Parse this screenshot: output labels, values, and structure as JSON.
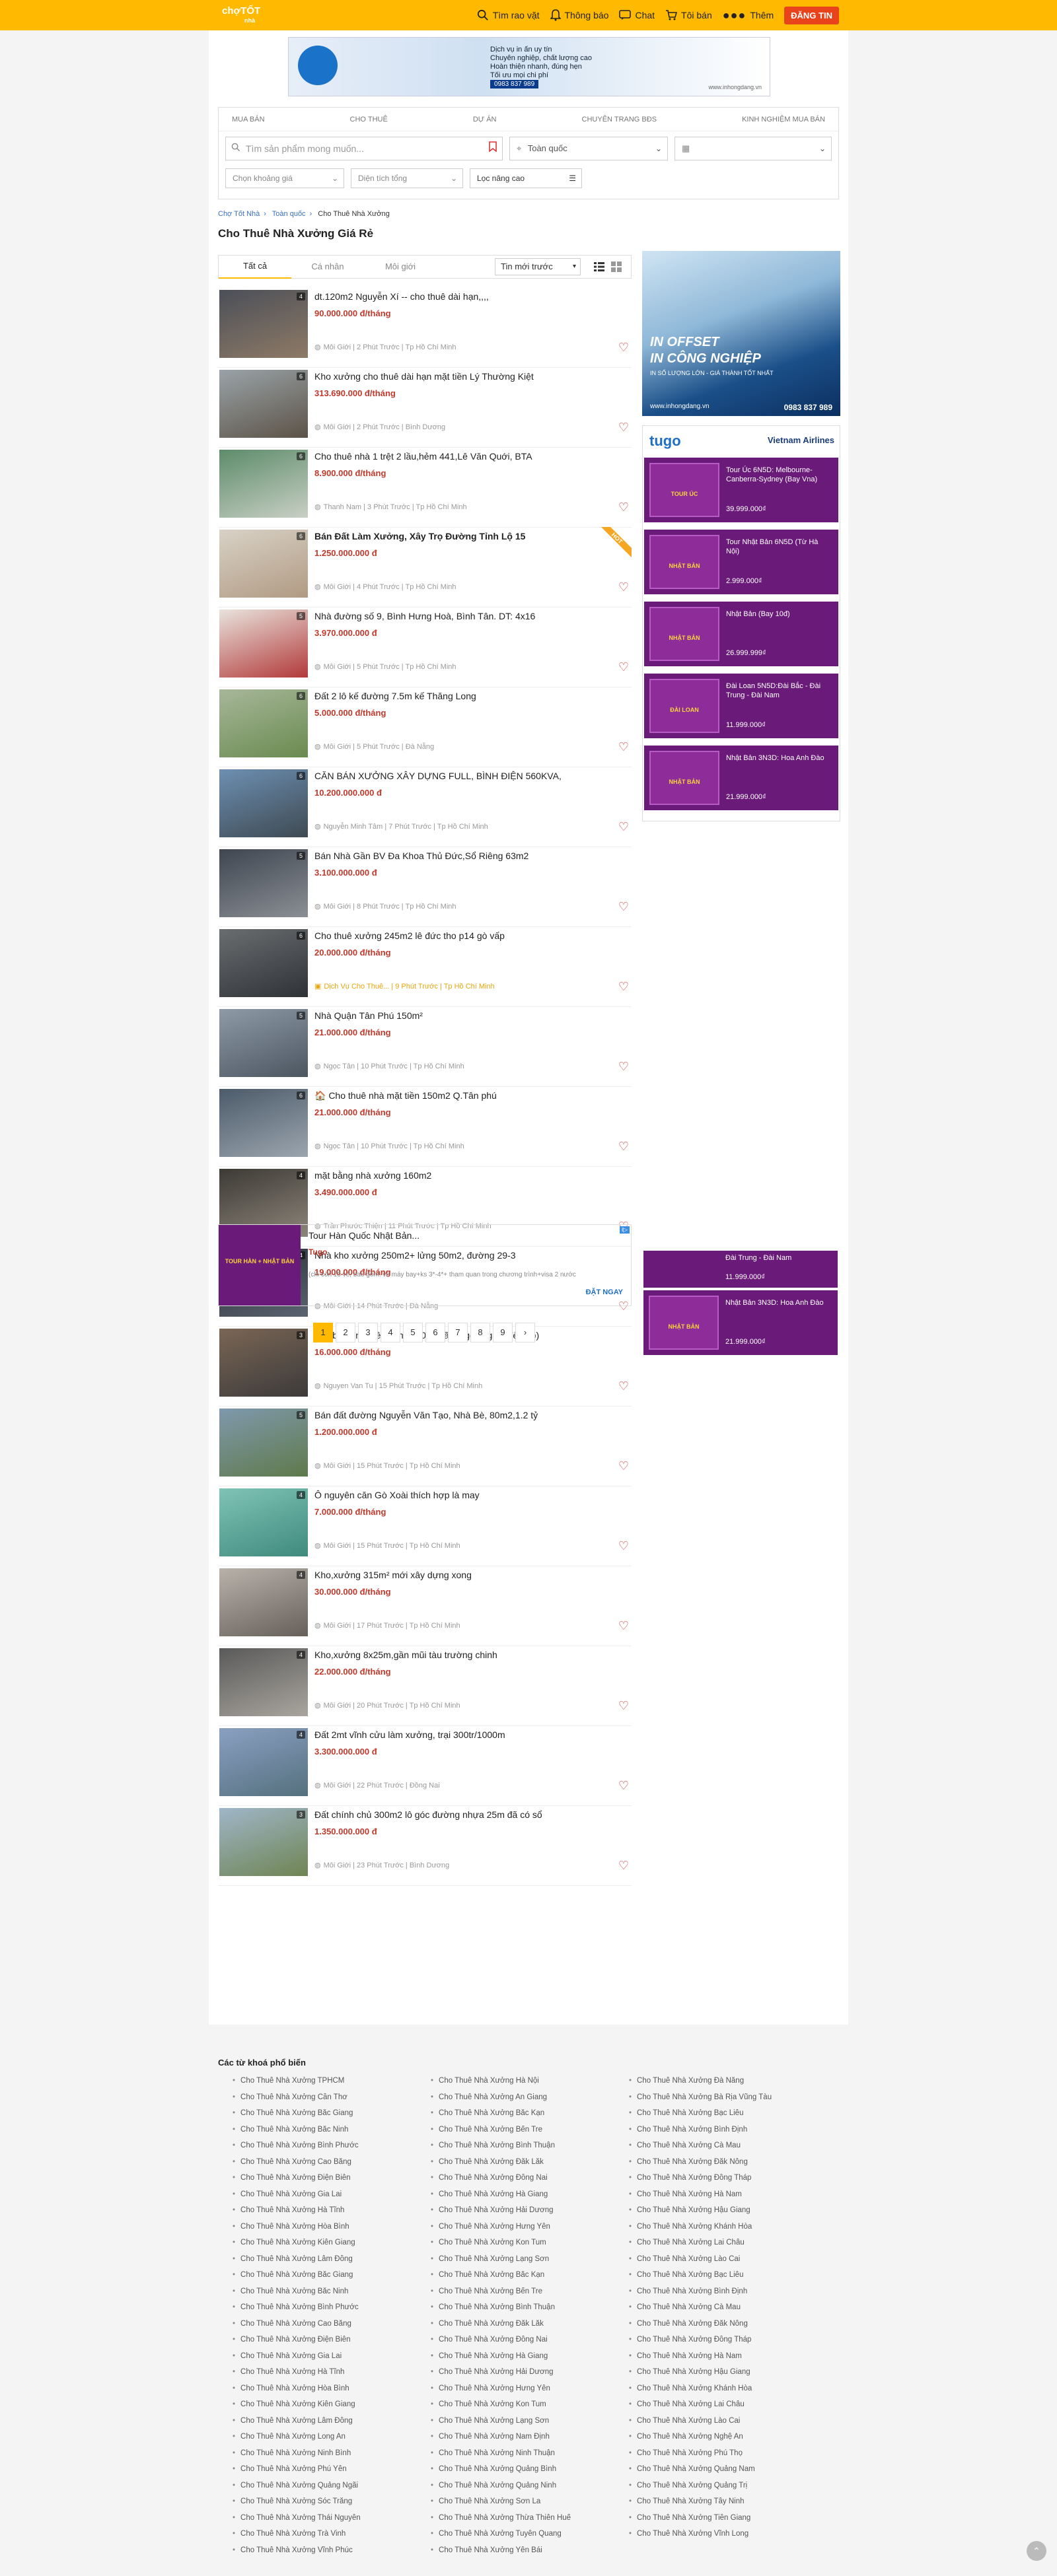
{
  "header": {
    "logo": "chợTỐT",
    "logo_sub": "nhà",
    "nav": [
      {
        "label": "Tìm rao vặt",
        "icon": "search-icon"
      },
      {
        "label": "Thông báo",
        "icon": "bell-icon"
      },
      {
        "label": "Chat",
        "icon": "chat-icon"
      },
      {
        "label": "Tôi bán",
        "icon": "cart-icon"
      },
      {
        "label": "Thêm",
        "icon": "more-icon"
      }
    ],
    "post_button": "ĐĂNG TIN"
  },
  "top_banner": {
    "lines": [
      "Dịch vụ in ấn uy tín",
      "Chuyên nghiệp, chất lượng cao",
      "Hoàn thiện nhanh, đúng hẹn",
      "Tối ưu mọi chi phí"
    ],
    "phone": "0983 837 989",
    "url": "www.inhongdang.vn"
  },
  "search": {
    "categories": [
      "MUA BÁN",
      "CHO THUÊ",
      "DỰ ÁN",
      "CHUYÊN TRANG BĐS",
      "KINH NGHIỆM MUA BÁN"
    ],
    "placeholder": "Tìm sản phẩm mong muốn...",
    "location": "Toàn quốc",
    "type_select": "",
    "price_filter": "Chọn khoảng giá",
    "area_filter": "Diện tích tổng",
    "advanced": "Lọc nâng cao"
  },
  "breadcrumb": [
    "Chợ Tốt Nhà",
    "Toàn quốc",
    "Cho Thuê Nhà Xưởng"
  ],
  "page_title": "Cho Thuê Nhà Xưởng Giá Rẻ",
  "tabs": [
    "Tất cả",
    "Cá nhân",
    "Môi giới"
  ],
  "sort": "Tin mới trước",
  "listings": [
    {
      "title": "dt.120m2 Nguyễn Xí -- cho thuê dài hạn,,,,",
      "price": "90.000.000 đ/tháng",
      "meta": "Môi Giới | 2 Phút Trước | Tp Hồ Chí Minh",
      "count": "4",
      "colors": [
        "#4b4f58",
        "#8e7a66"
      ]
    },
    {
      "title": "Kho xưởng cho thuê dài hạn mặt tiền Lý Thường Kiệt",
      "price": "313.690.000 đ/tháng",
      "meta": "Môi Giới | 2 Phút Trước | Bình Dương",
      "count": "6",
      "colors": [
        "#9aa3a8",
        "#5c5347"
      ]
    },
    {
      "title": "Cho thuê nhà 1 trệt 2 lầu,hẻm 441,Lê Văn Quới, BTA",
      "price": "8.900.000 đ/tháng",
      "meta": "Thanh Nam | 3 Phút Trước | Tp Hồ Chí Minh",
      "count": "6",
      "colors": [
        "#5d8c6a",
        "#c8cfc4"
      ]
    },
    {
      "title": "Bán Đất Làm Xưởng, Xây Trọ Đường Tỉnh Lộ 15",
      "price": "1.250.000.000 đ",
      "meta": "Môi Giới | 4 Phút Trước | Tp Hồ Chí Minh",
      "count": "6",
      "colors": [
        "#d8d2c6",
        "#b19a83"
      ],
      "bold": true,
      "hot": "HOT"
    },
    {
      "title": "Nhà đường số 9, Bình Hưng Hoà, Bình Tân. DT: 4x16",
      "price": "3.970.000.000 đ",
      "meta": "Môi Giới | 5 Phút Trước | Tp Hồ Chí Minh",
      "count": "5",
      "colors": [
        "#e9e3dd",
        "#b23a3a"
      ]
    },
    {
      "title": "Đất 2 lô kế đường 7.5m kế Thăng Long",
      "price": "5.000.000 đ/tháng",
      "meta": "Môi Giới | 5 Phút Trước | Đà Nẵng",
      "count": "6",
      "colors": [
        "#a7b79a",
        "#6a8a4f"
      ]
    },
    {
      "title": "CĂN BÁN XƯỞNG XÂY DỰNG FULL, BÌNH ĐIỆN 560KVA,",
      "price": "10.200.000.000 đ",
      "meta": "Nguyễn Minh Tâm | 7 Phút Trước | Tp Hồ Chí Minh",
      "count": "6",
      "colors": [
        "#6d8fb2",
        "#3e4a52"
      ]
    },
    {
      "title": "Bán Nhà Gần BV Đa Khoa Thủ Đức,Sổ Riêng 63m2",
      "price": "3.100.000.000 đ",
      "meta": "Môi Giới | 8 Phút Trước | Tp Hồ Chí Minh",
      "count": "5",
      "colors": [
        "#3f4650",
        "#8a8f95"
      ]
    },
    {
      "title": "Cho thuê xưởng 245m2 lê đức tho p14 gò vấp",
      "price": "20.000.000 đ/tháng",
      "meta": "Dịch Vụ Cho Thuê... | 9 Phút Trước | Tp Hồ Chí Minh",
      "count": "6",
      "colors": [
        "#6a6d70",
        "#2f3236"
      ],
      "shop": true
    },
    {
      "title": "Nhà Quận Tân Phú 150m²",
      "price": "21.000.000 đ/tháng",
      "meta": "Ngọc Tân | 10 Phút Trước | Tp Hồ Chí Minh",
      "count": "5",
      "colors": [
        "#8e9aa6",
        "#4b5661"
      ]
    },
    {
      "title": "🏠 Cho thuê nhà mặt tiền 150m2 Q.Tân phú",
      "price": "21.000.000 đ/tháng",
      "meta": "Ngọc Tân | 10 Phút Trước | Tp Hồ Chí Minh",
      "count": "6",
      "colors": [
        "#4c5b6a",
        "#9ba5ae"
      ]
    },
    {
      "title": "mặt bằng nhà xưởng 160m2",
      "price": "3.490.000.000 đ",
      "meta": "Trần Phước Thiện | 11 Phút Trước | Tp Hồ Chí Minh",
      "count": "4",
      "colors": [
        "#3d3a35",
        "#8c857a"
      ]
    },
    {
      "title": "Nhà kho xưởng 250m2+ lửng 50m2, đường 29-3",
      "price": "19.000.000 đ/tháng",
      "meta": "Môi Giới | 14 Phút Trước | Đà Nẵng",
      "count": "4",
      "colors": [
        "#2a2e36",
        "#5a6370"
      ]
    },
    {
      "title": "mặt bằng nguyên căn 4x40m mã lò (góc ngã 4 đèn đỏ)",
      "price": "16.000.000 đ/tháng",
      "meta": "Nguyen Van Tu | 15 Phút Trước | Tp Hồ Chí Minh",
      "count": "3",
      "colors": [
        "#7a6655",
        "#3c3a3a"
      ]
    },
    {
      "title": "Bán đất đường Nguyễn Văn Tạo, Nhà Bè, 80m2,1.2 tỷ",
      "price": "1.200.000.000 đ",
      "meta": "Môi Giới | 15 Phút Trước | Tp Hồ Chí Minh",
      "count": "5",
      "colors": [
        "#7f98ad",
        "#5e7a4a"
      ]
    },
    {
      "title": "Ô nguyên căn Gò Xoài thích hợp là may",
      "price": "7.000.000 đ/tháng",
      "meta": "Môi Giới | 15 Phút Trước | Tp Hồ Chí Minh",
      "count": "4",
      "colors": [
        "#7fc3b6",
        "#3f8a7d"
      ]
    },
    {
      "title": "Kho,xưởng 315m² mới xây dựng xong",
      "price": "30.000.000 đ/tháng",
      "meta": "Môi Giới | 17 Phút Trước | Tp Hồ Chí Minh",
      "count": "4",
      "colors": [
        "#b7b2aa",
        "#66605a"
      ]
    },
    {
      "title": "Kho,xưởng 8x25m,gần mũi tàu trường chinh",
      "price": "22.000.000 đ/tháng",
      "meta": "Môi Giới | 20 Phút Trước | Tp Hồ Chí Minh",
      "count": "4",
      "colors": [
        "#5a5a5a",
        "#a9a59e"
      ]
    },
    {
      "title": "Đất 2mt vĩnh cửu làm xưởng, trại 300tr/1000m",
      "price": "3.300.000.000 đ",
      "meta": "Môi Giới | 22 Phút Trước | Đồng Nai",
      "count": "4",
      "colors": [
        "#8aa0c2",
        "#55707e"
      ]
    },
    {
      "title": "Đất chính chủ 300m2 lô góc đường nhựa 25m đã có sổ",
      "price": "1.350.000.000 đ",
      "meta": "Môi Giới | 23 Phút Trước | Bình Dương",
      "count": "3",
      "colors": [
        "#9fb6c9",
        "#6f8452"
      ]
    }
  ],
  "sidebar_ad1": {
    "headline1": "IN OFFSET",
    "headline2": "IN CÔNG NGHIỆP",
    "sub": "IN SỐ LƯỢNG LỚN - GIÁ THÀNH TỐT NHẤT",
    "url": "www.inhongdang.vn",
    "phone": "0983 837 989"
  },
  "sidebar_ad2": {
    "brand": "tugo",
    "airline": "Vietnam Airlines",
    "items": [
      {
        "title": "Tour Úc 6N5D: Melbourne-Canberra-Sydney (Bay Vna)",
        "price": "39.999.000₫",
        "label": "TOUR ÚC"
      },
      {
        "title": "Tour Nhật Bản 6N5D (Từ Hà Nội)",
        "price": "2.999.000₫",
        "label": "NHẬT BẢN"
      },
      {
        "title": "Nhật Bản (Bay 10đ)",
        "price": "26.999.999₫",
        "label": "NHẬT BẢN"
      },
      {
        "title": "Đài Loan 5N5D:Đài Bắc - Đài Trung - Đài Nam",
        "price": "11.999.000₫",
        "label": "ĐÀI LOAN"
      },
      {
        "title": "Nhật Bản 3N3D: Hoa Anh Đào",
        "price": "21.999.000₫",
        "label": "NHẬT BẢN"
      }
    ]
  },
  "sticky_ad": {
    "items": [
      {
        "title": "Đài Trung - Đài Nam",
        "price": "11.999.000₫"
      },
      {
        "title": "Nhật Bản 3N3D: Hoa Anh Đào",
        "price": "21.999.000₫",
        "label": "NHẬT BẢN"
      }
    ]
  },
  "native_ad": {
    "title": "Tour Hàn Quốc Nhật Bản...",
    "brand": "Tugo",
    "desc": "(chi còn 10 vé, bao gồm: vé máy bay+ks 3*-4*+ tham quan trong chương trình+visa 2 nước",
    "cta": "ĐẶT NGAY",
    "ad_tag": "i▷",
    "label": "TOUR HÀN + NHẬT BẢN"
  },
  "pagination": [
    "1",
    "2",
    "3",
    "4",
    "5",
    "6",
    "7",
    "8",
    "9",
    "›"
  ],
  "footer": {
    "title": "Các từ khoá phổ biến",
    "col1": [
      "Cho Thuê Nhà Xưởng TPHCM",
      "Cho Thuê Nhà Xưởng Cần Thơ",
      "Cho Thuê Nhà Xưởng Bắc Giang",
      "Cho Thuê Nhà Xưởng Bắc Ninh",
      "Cho Thuê Nhà Xưởng Bình Phước",
      "Cho Thuê Nhà Xưởng Cao Bằng",
      "Cho Thuê Nhà Xưởng Điện Biên",
      "Cho Thuê Nhà Xưởng Gia Lai",
      "Cho Thuê Nhà Xưởng Hà Tĩnh",
      "Cho Thuê Nhà Xưởng Hòa Bình",
      "Cho Thuê Nhà Xưởng Kiên Giang",
      "Cho Thuê Nhà Xưởng Lâm Đồng",
      "Cho Thuê Nhà Xưởng Bắc Giang",
      "Cho Thuê Nhà Xưởng Bắc Ninh",
      "Cho Thuê Nhà Xưởng Bình Phước",
      "Cho Thuê Nhà Xưởng Cao Bằng",
      "Cho Thuê Nhà Xưởng Điện Biên",
      "Cho Thuê Nhà Xưởng Gia Lai",
      "Cho Thuê Nhà Xưởng Hà Tĩnh",
      "Cho Thuê Nhà Xưởng Hòa Bình",
      "Cho Thuê Nhà Xưởng Kiên Giang",
      "Cho Thuê Nhà Xưởng Lâm Đồng",
      "Cho Thuê Nhà Xưởng Long An",
      "Cho Thuê Nhà Xưởng Ninh Bình",
      "Cho Thuê Nhà Xưởng Phú Yên",
      "Cho Thuê Nhà Xưởng Quảng Ngãi",
      "Cho Thuê Nhà Xưởng Sóc Trăng",
      "Cho Thuê Nhà Xưởng Thái Nguyên",
      "Cho Thuê Nhà Xưởng Trà Vinh",
      "Cho Thuê Nhà Xưởng Vĩnh Phúc"
    ],
    "col2": [
      "Cho Thuê Nhà Xưởng Hà Nội",
      "Cho Thuê Nhà Xưởng An Giang",
      "Cho Thuê Nhà Xưởng Bắc Kạn",
      "Cho Thuê Nhà Xưởng Bến Tre",
      "Cho Thuê Nhà Xưởng Bình Thuận",
      "Cho Thuê Nhà Xưởng Đắk Lắk",
      "Cho Thuê Nhà Xưởng Đồng Nai",
      "Cho Thuê Nhà Xưởng Hà Giang",
      "Cho Thuê Nhà Xưởng Hải Dương",
      "Cho Thuê Nhà Xưởng Hưng Yên",
      "Cho Thuê Nhà Xưởng Kon Tum",
      "Cho Thuê Nhà Xưởng Lạng Sơn",
      "Cho Thuê Nhà Xưởng Bắc Kạn",
      "Cho Thuê Nhà Xưởng Bến Tre",
      "Cho Thuê Nhà Xưởng Bình Thuận",
      "Cho Thuê Nhà Xưởng Đắk Lắk",
      "Cho Thuê Nhà Xưởng Đồng Nai",
      "Cho Thuê Nhà Xưởng Hà Giang",
      "Cho Thuê Nhà Xưởng Hải Dương",
      "Cho Thuê Nhà Xưởng Hưng Yên",
      "Cho Thuê Nhà Xưởng Kon Tum",
      "Cho Thuê Nhà Xưởng Lạng Sơn",
      "Cho Thuê Nhà Xưởng Nam Định",
      "Cho Thuê Nhà Xưởng Ninh Thuận",
      "Cho Thuê Nhà Xưởng Quảng Bình",
      "Cho Thuê Nhà Xưởng Quảng Ninh",
      "Cho Thuê Nhà Xưởng Sơn La",
      "Cho Thuê Nhà Xưởng Thừa Thiên Huế",
      "Cho Thuê Nhà Xưởng Tuyên Quang",
      "Cho Thuê Nhà Xưởng Yên Bái"
    ],
    "col3": [
      "Cho Thuê Nhà Xưởng Đà Nẵng",
      "Cho Thuê Nhà Xưởng Bà Rịa Vũng Tàu",
      "Cho Thuê Nhà Xưởng Bạc Liêu",
      "Cho Thuê Nhà Xưởng Bình Định",
      "Cho Thuê Nhà Xưởng Cà Mau",
      "Cho Thuê Nhà Xưởng Đắk Nông",
      "Cho Thuê Nhà Xưởng Đồng Tháp",
      "Cho Thuê Nhà Xưởng Hà Nam",
      "Cho Thuê Nhà Xưởng Hậu Giang",
      "Cho Thuê Nhà Xưởng Khánh Hòa",
      "Cho Thuê Nhà Xưởng Lai Châu",
      "Cho Thuê Nhà Xưởng Lào Cai",
      "Cho Thuê Nhà Xưởng Bạc Liêu",
      "Cho Thuê Nhà Xưởng Bình Định",
      "Cho Thuê Nhà Xưởng Cà Mau",
      "Cho Thuê Nhà Xưởng Đắk Nông",
      "Cho Thuê Nhà Xưởng Đồng Tháp",
      "Cho Thuê Nhà Xưởng Hà Nam",
      "Cho Thuê Nhà Xưởng Hậu Giang",
      "Cho Thuê Nhà Xưởng Khánh Hòa",
      "Cho Thuê Nhà Xưởng Lai Châu",
      "Cho Thuê Nhà Xưởng Lào Cai",
      "Cho Thuê Nhà Xưởng Nghệ An",
      "Cho Thuê Nhà Xưởng Phú Thọ",
      "Cho Thuê Nhà Xưởng Quảng Nam",
      "Cho Thuê Nhà Xưởng Quảng Trị",
      "Cho Thuê Nhà Xưởng Tây Ninh",
      "Cho Thuê Nhà Xưởng Tiền Giang",
      "Cho Thuê Nhà Xưởng Vĩnh Long"
    ]
  },
  "colors": {
    "brand": "#ffba00",
    "price": "#c0392b",
    "heart": "#d43a3a",
    "link": "#3a6fc2",
    "ad_purple": "#6a1b7a"
  }
}
